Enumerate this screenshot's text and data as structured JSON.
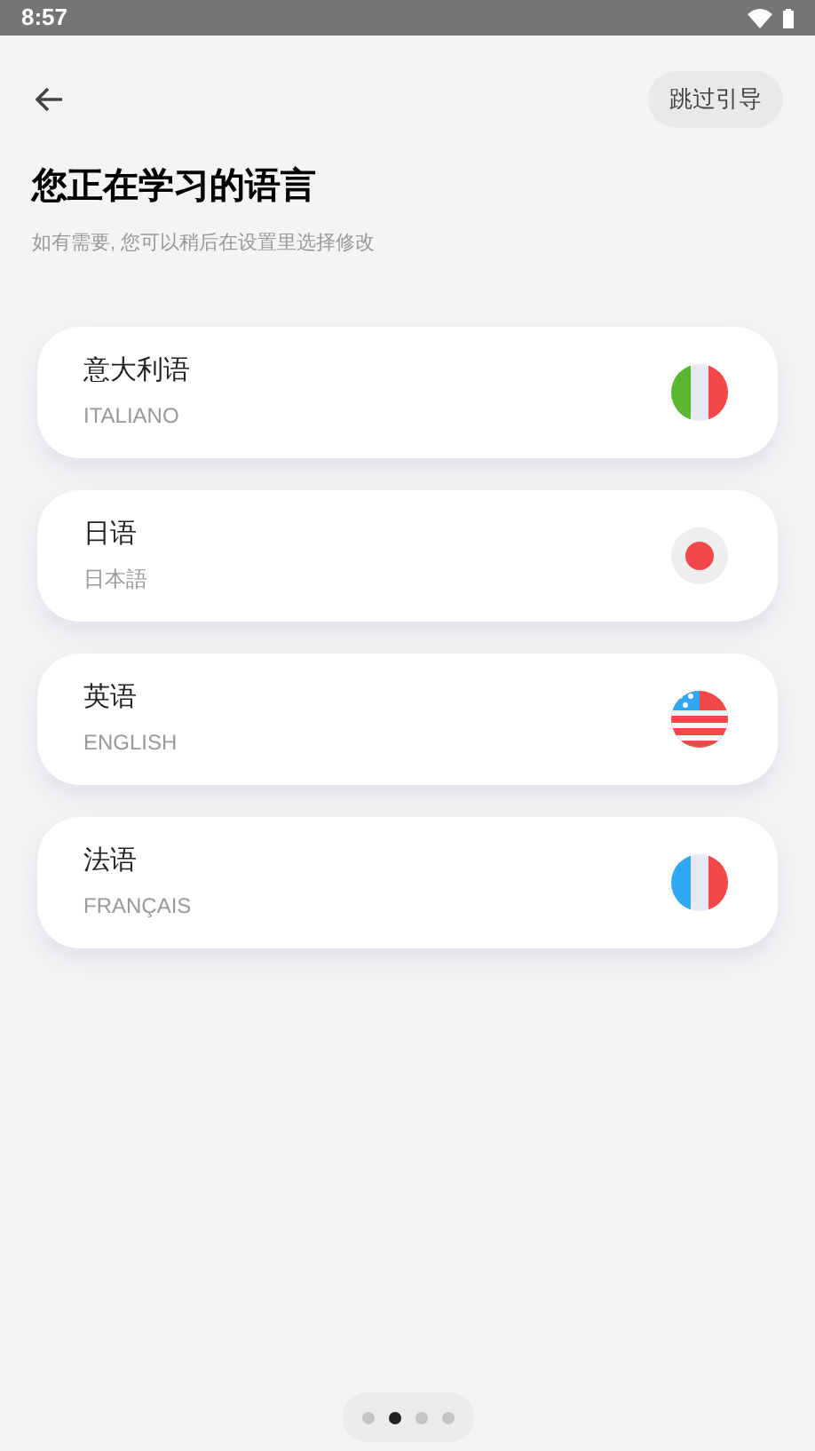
{
  "status_bar": {
    "time": "8:57"
  },
  "skip_button": "跳过引导",
  "title": "您正在学习的语言",
  "subtitle": "如有需要, 您可以稍后在设置里选择修改",
  "languages": [
    {
      "name": "意大利语",
      "native": "ITALIANO",
      "kind": "italy"
    },
    {
      "name": "日语",
      "native": "日本語",
      "kind": "japan"
    },
    {
      "name": "英语",
      "native": "ENGLISH",
      "kind": "usa"
    },
    {
      "name": "法语",
      "native": "FRANÇAIS",
      "kind": "france"
    }
  ],
  "page_dots": [
    {
      "selected": false
    },
    {
      "selected": true
    },
    {
      "selected": false
    },
    {
      "selected": false
    }
  ]
}
